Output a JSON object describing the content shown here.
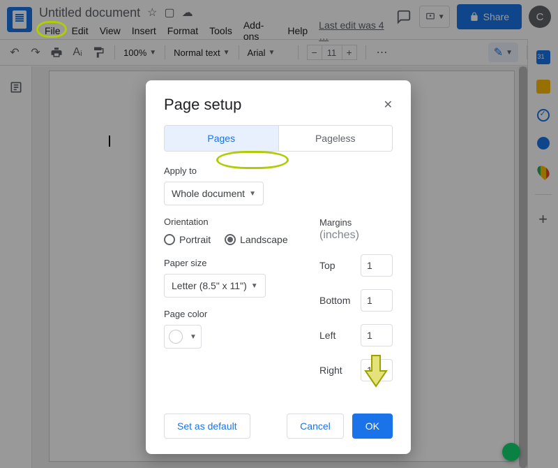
{
  "header": {
    "doc_title": "Untitled document",
    "menu": {
      "file": "File",
      "edit": "Edit",
      "view": "View",
      "insert": "Insert",
      "format": "Format",
      "tools": "Tools",
      "addons": "Add-ons",
      "help": "Help"
    },
    "last_edit": "Last edit was 4 …",
    "share_label": "Share",
    "avatar_letter": "C"
  },
  "toolbar": {
    "zoom": "100%",
    "style": "Normal text",
    "font": "Arial",
    "size": "11"
  },
  "dialog": {
    "title": "Page setup",
    "tab_pages": "Pages",
    "tab_pageless": "Pageless",
    "apply_to_label": "Apply to",
    "apply_to_value": "Whole document",
    "orientation_label": "Orientation",
    "portrait": "Portrait",
    "landscape": "Landscape",
    "orientation_selected": "landscape",
    "paper_size_label": "Paper size",
    "paper_size_value": "Letter (8.5\" x 11\")",
    "page_color_label": "Page color",
    "margins_label": "Margins",
    "margins_unit": "(inches)",
    "margin_top_label": "Top",
    "margin_top_value": "1",
    "margin_bottom_label": "Bottom",
    "margin_bottom_value": "1",
    "margin_left_label": "Left",
    "margin_left_value": "1",
    "margin_right_label": "Right",
    "margin_right_value": "1",
    "set_default": "Set as default",
    "cancel": "Cancel",
    "ok": "OK"
  },
  "annotations": {
    "highlight_file": true,
    "highlight_landscape": true,
    "arrow_to_ok": true,
    "color": "#b0cc07"
  }
}
